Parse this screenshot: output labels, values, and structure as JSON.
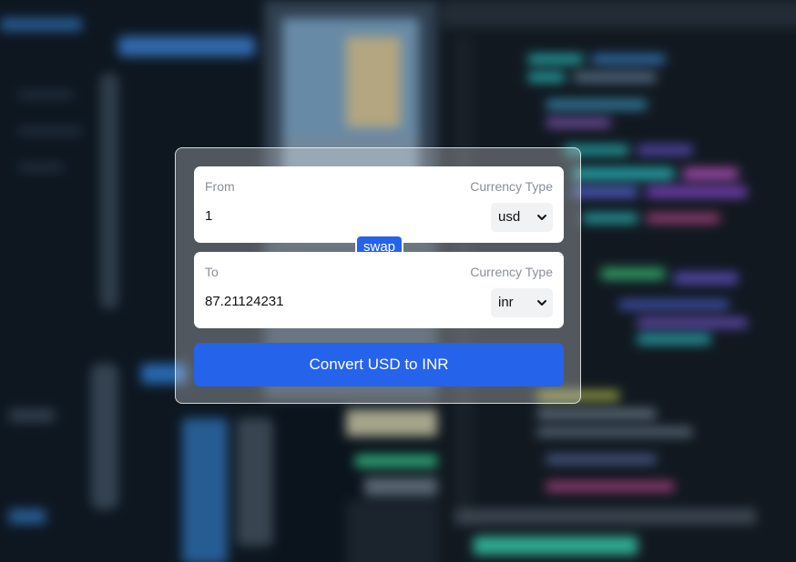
{
  "converter": {
    "from": {
      "label": "From",
      "currency_type_label": "Currency Type",
      "amount": "1",
      "currency": "usd"
    },
    "swap_label": "swap",
    "to": {
      "label": "To",
      "currency_type_label": "Currency Type",
      "amount": "87.21124231",
      "currency": "inr"
    },
    "convert_label": "Convert USD to INR"
  },
  "colors": {
    "accent": "#2563eb",
    "card_bg": "#ffffff",
    "muted_text": "#8a8f98"
  },
  "background": {
    "description_icon": "blurred-code-editor-photo"
  }
}
